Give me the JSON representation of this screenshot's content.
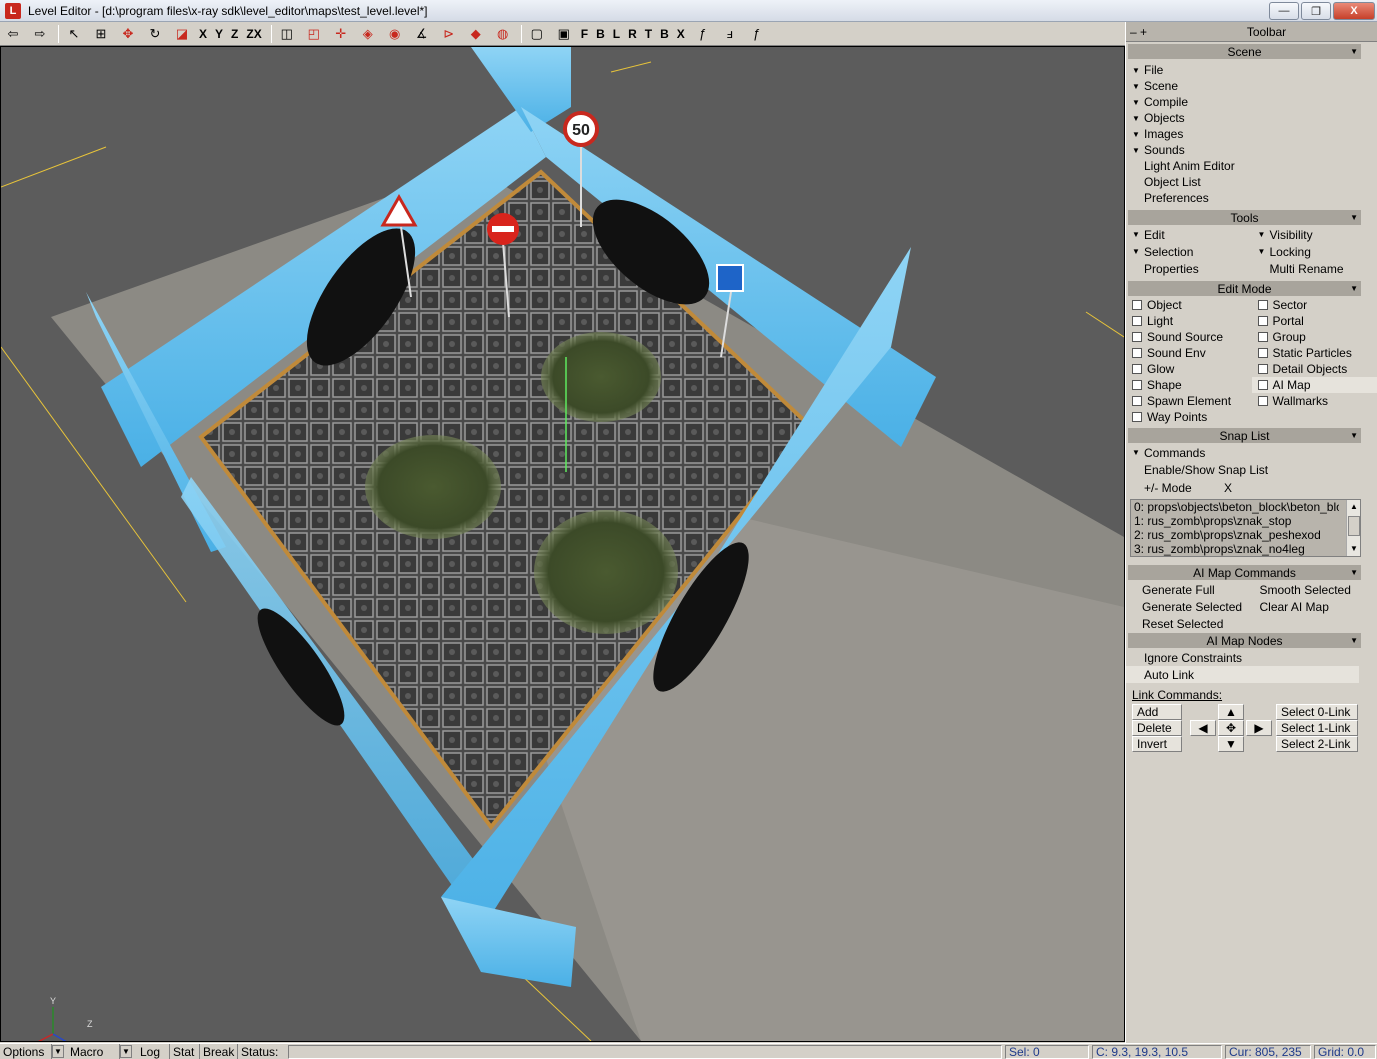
{
  "window": {
    "title": "Level Editor - [d:\\program files\\x-ray sdk\\level_editor\\maps\\test_level.level*]",
    "app_icon_letter": "L",
    "minimize_glyph": "—",
    "maximize_glyph": "❐",
    "close_glyph": "X"
  },
  "toolbar": {
    "axis_x": "X",
    "axis_y": "Y",
    "axis_z": "Z",
    "axis_zx": "ZX",
    "view_f": "F",
    "view_b": "B",
    "view_l": "L",
    "view_r": "R",
    "view_t": "T",
    "view_bb": "B",
    "view_x": "X"
  },
  "viewport": {
    "speed_sign": "50",
    "gizmo_y": "Y",
    "gizmo_z": "Z"
  },
  "statusbar": {
    "options": "Options",
    "macro": "Macro",
    "log": "Log",
    "stat": "Stat",
    "break": "Break",
    "status": "Status:",
    "sel": "Sel: 0",
    "cursor": "C: 9.3, 19.3, 10.5",
    "cur": "Cur: 805, 235",
    "grid": "Grid: 0.0"
  },
  "panel": {
    "title": "Toolbar",
    "minus_plus": "– +",
    "scene": {
      "header": "Scene",
      "items": [
        "File",
        "Scene",
        "Compile",
        "Objects",
        "Images",
        "Sounds"
      ],
      "plain_items": [
        "Light Anim Editor",
        "Object List",
        "Preferences"
      ]
    },
    "tools": {
      "header": "Tools",
      "left": [
        "Edit",
        "Selection"
      ],
      "right": [
        "Visibility",
        "Locking"
      ],
      "properties": "Properties",
      "multi_rename": "Multi Rename"
    },
    "edit_mode": {
      "header": "Edit Mode",
      "left": [
        "Object",
        "Light",
        "Sound Source",
        "Sound Env",
        "Glow",
        "Shape",
        "Spawn Element",
        "Way Points"
      ],
      "right": [
        "Sector",
        "Portal",
        "Group",
        "Static Particles",
        "Detail Objects",
        "AI Map",
        "Wallmarks"
      ]
    },
    "snap_list": {
      "header": "Snap List",
      "commands": "Commands",
      "enable_show": "Enable/Show Snap List",
      "mode": "+/- Mode",
      "clear": "X",
      "entries": [
        "0: props\\objects\\beton_block\\beton_blo",
        "1: rus_zomb\\props\\znak_stop",
        "2: rus_zomb\\props\\znak_peshexod",
        "3: rus_zomb\\props\\znak_no4leg"
      ]
    },
    "ai_map_commands": {
      "header": "AI Map Commands",
      "generate_full": "Generate Full",
      "smooth_selected": "Smooth Selected",
      "generate_selected": "Generate Selected",
      "clear_ai_map": "Clear AI Map",
      "reset_selected": "Reset Selected"
    },
    "ai_map_nodes": {
      "header": "AI Map Nodes",
      "ignore_constraints": "Ignore Constraints",
      "auto_link": "Auto Link"
    },
    "link_commands": {
      "label": "Link Commands:",
      "add": "Add",
      "delete": "Delete",
      "invert": "Invert",
      "select0": "Select 0-Link",
      "select1": "Select 1-Link",
      "select2": "Select 2-Link"
    }
  }
}
